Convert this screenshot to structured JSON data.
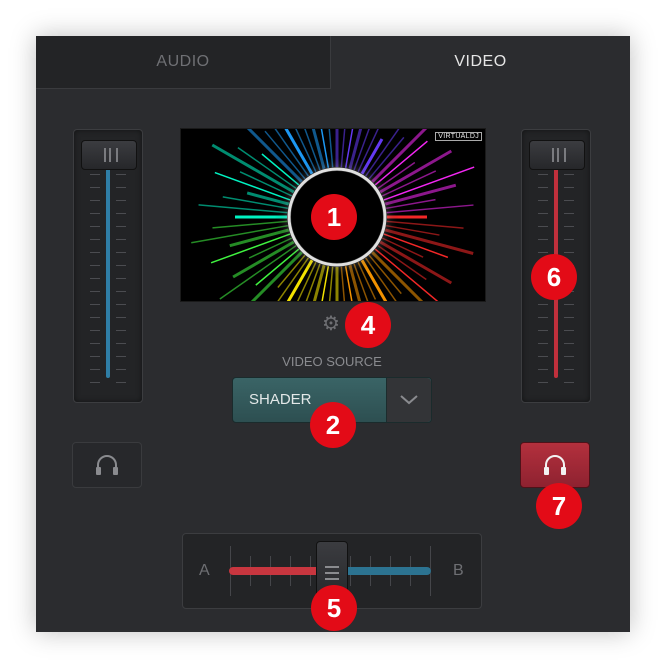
{
  "tabs": [
    {
      "label": "AUDIO",
      "active": false
    },
    {
      "label": "VIDEO",
      "active": true
    }
  ],
  "preview": {
    "badge_text": "VIRTUALDJ"
  },
  "video_source": {
    "heading": "VIDEO SOURCE",
    "selected": "SHADER"
  },
  "crossfader": {
    "left_label": "A",
    "right_label": "B",
    "position": 0.5
  },
  "left_deck": {
    "volume_level": 1.0,
    "track_color": "#2f7ea6",
    "headphone_active": false
  },
  "right_deck": {
    "volume_level": 1.0,
    "track_color": "#c0303c",
    "headphone_active": true
  },
  "colors": {
    "panel": "#2b2c2f",
    "active_red": "#b3303d",
    "marker_red": "#e30b17",
    "source_teal": "#3a6466"
  },
  "icons": {
    "settings": "gear-icon",
    "dropdown": "chevron-down-icon",
    "headphones": "headphones-icon"
  },
  "markers": [
    "1",
    "2",
    "4",
    "5",
    "6",
    "7"
  ]
}
